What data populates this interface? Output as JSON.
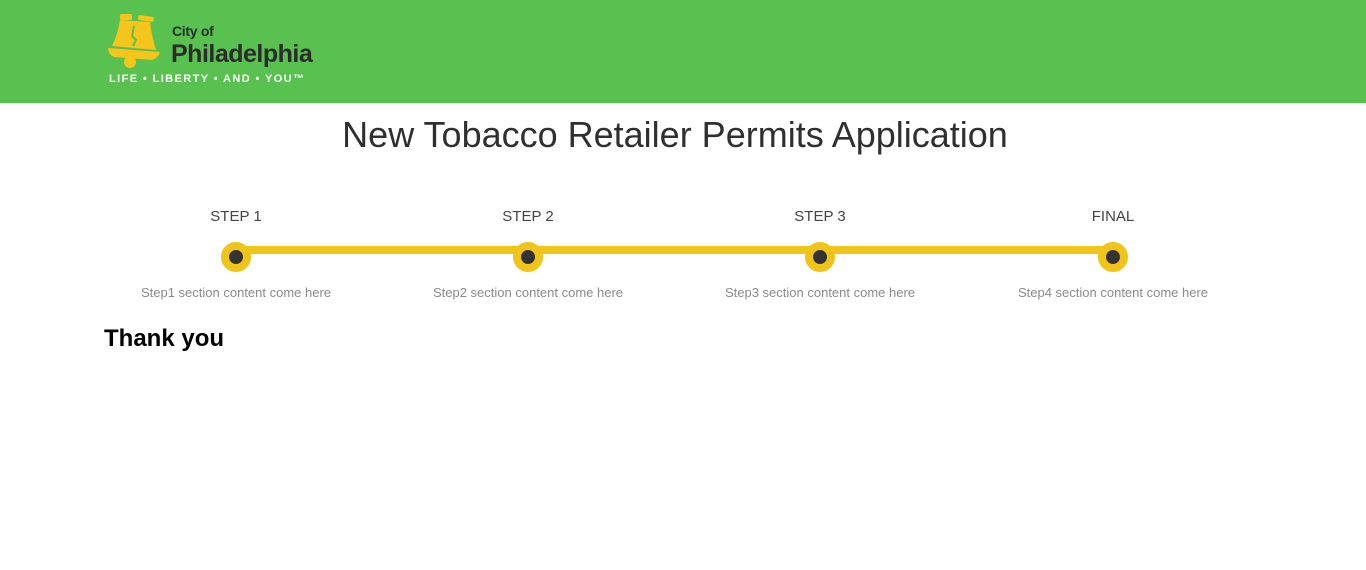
{
  "header": {
    "logo": {
      "city_of": "City of",
      "city_name": "Philadelphia",
      "tagline": "LIFE • LIBERTY • AND • YOU™"
    },
    "background_color": "#58c14f"
  },
  "page_title": "New Tobacco Retailer Permits Application",
  "stepper": {
    "accent_color": "#f0c419",
    "steps": [
      {
        "label": "STEP 1",
        "description": "Step1 section content come here"
      },
      {
        "label": "STEP 2",
        "description": "Step2 section content come here"
      },
      {
        "label": "STEP 3",
        "description": "Step3 section content come here"
      },
      {
        "label": "FINAL",
        "description": "Step4 section content come here"
      }
    ]
  },
  "main": {
    "message": "Thank you"
  }
}
